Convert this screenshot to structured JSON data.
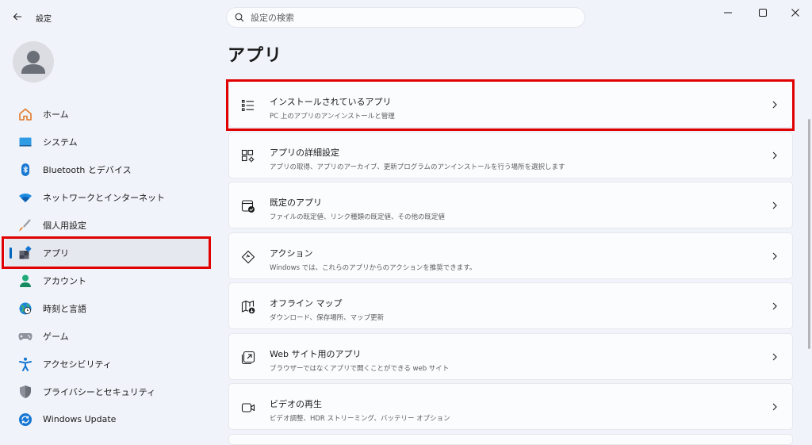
{
  "window": {
    "app_title": "設定",
    "search_placeholder": "設定の検索"
  },
  "sidebar": {
    "items": [
      {
        "label": "ホーム",
        "icon": "home-icon"
      },
      {
        "label": "システム",
        "icon": "system-icon"
      },
      {
        "label": "Bluetooth とデバイス",
        "icon": "bluetooth-icon"
      },
      {
        "label": "ネットワークとインターネット",
        "icon": "wifi-icon"
      },
      {
        "label": "個人用設定",
        "icon": "brush-icon"
      },
      {
        "label": "アプリ",
        "icon": "apps-icon",
        "active": true
      },
      {
        "label": "アカウント",
        "icon": "account-icon"
      },
      {
        "label": "時刻と言語",
        "icon": "globe-clock-icon"
      },
      {
        "label": "ゲーム",
        "icon": "gamepad-icon"
      },
      {
        "label": "アクセシビリティ",
        "icon": "accessibility-icon"
      },
      {
        "label": "プライバシーとセキュリティ",
        "icon": "shield-icon"
      },
      {
        "label": "Windows Update",
        "icon": "update-icon"
      }
    ]
  },
  "main": {
    "title": "アプリ",
    "cards": [
      {
        "title": "インストールされているアプリ",
        "subtitle": "PC 上のアプリのアンインストールと管理",
        "icon": "list-icon"
      },
      {
        "title": "アプリの詳細設定",
        "subtitle": "アプリの取得、アプリのアーカイブ、更新プログラムのアンインストールを行う場所を選択します",
        "icon": "app-settings-icon"
      },
      {
        "title": "既定のアプリ",
        "subtitle": "ファイルの既定値、リンク種類の既定値、その他の既定値",
        "icon": "default-apps-icon"
      },
      {
        "title": "アクション",
        "subtitle": "Windows では、これらのアプリからのアクションを推奨できます。",
        "icon": "actions-icon"
      },
      {
        "title": "オフライン マップ",
        "subtitle": "ダウンロード、保存場所、マップ更新",
        "icon": "offline-map-icon"
      },
      {
        "title": "Web サイト用のアプリ",
        "subtitle": "ブラウザーではなくアプリで開くことができる web サイト",
        "icon": "web-apps-icon"
      },
      {
        "title": "ビデオの再生",
        "subtitle": "ビデオ調整、HDR ストリーミング、バッテリー オプション",
        "icon": "video-icon"
      }
    ]
  },
  "colors": {
    "accent": "#0067c0",
    "highlight": "#e00000",
    "background": "#f0f3f9",
    "card": "#fbfcfe"
  }
}
